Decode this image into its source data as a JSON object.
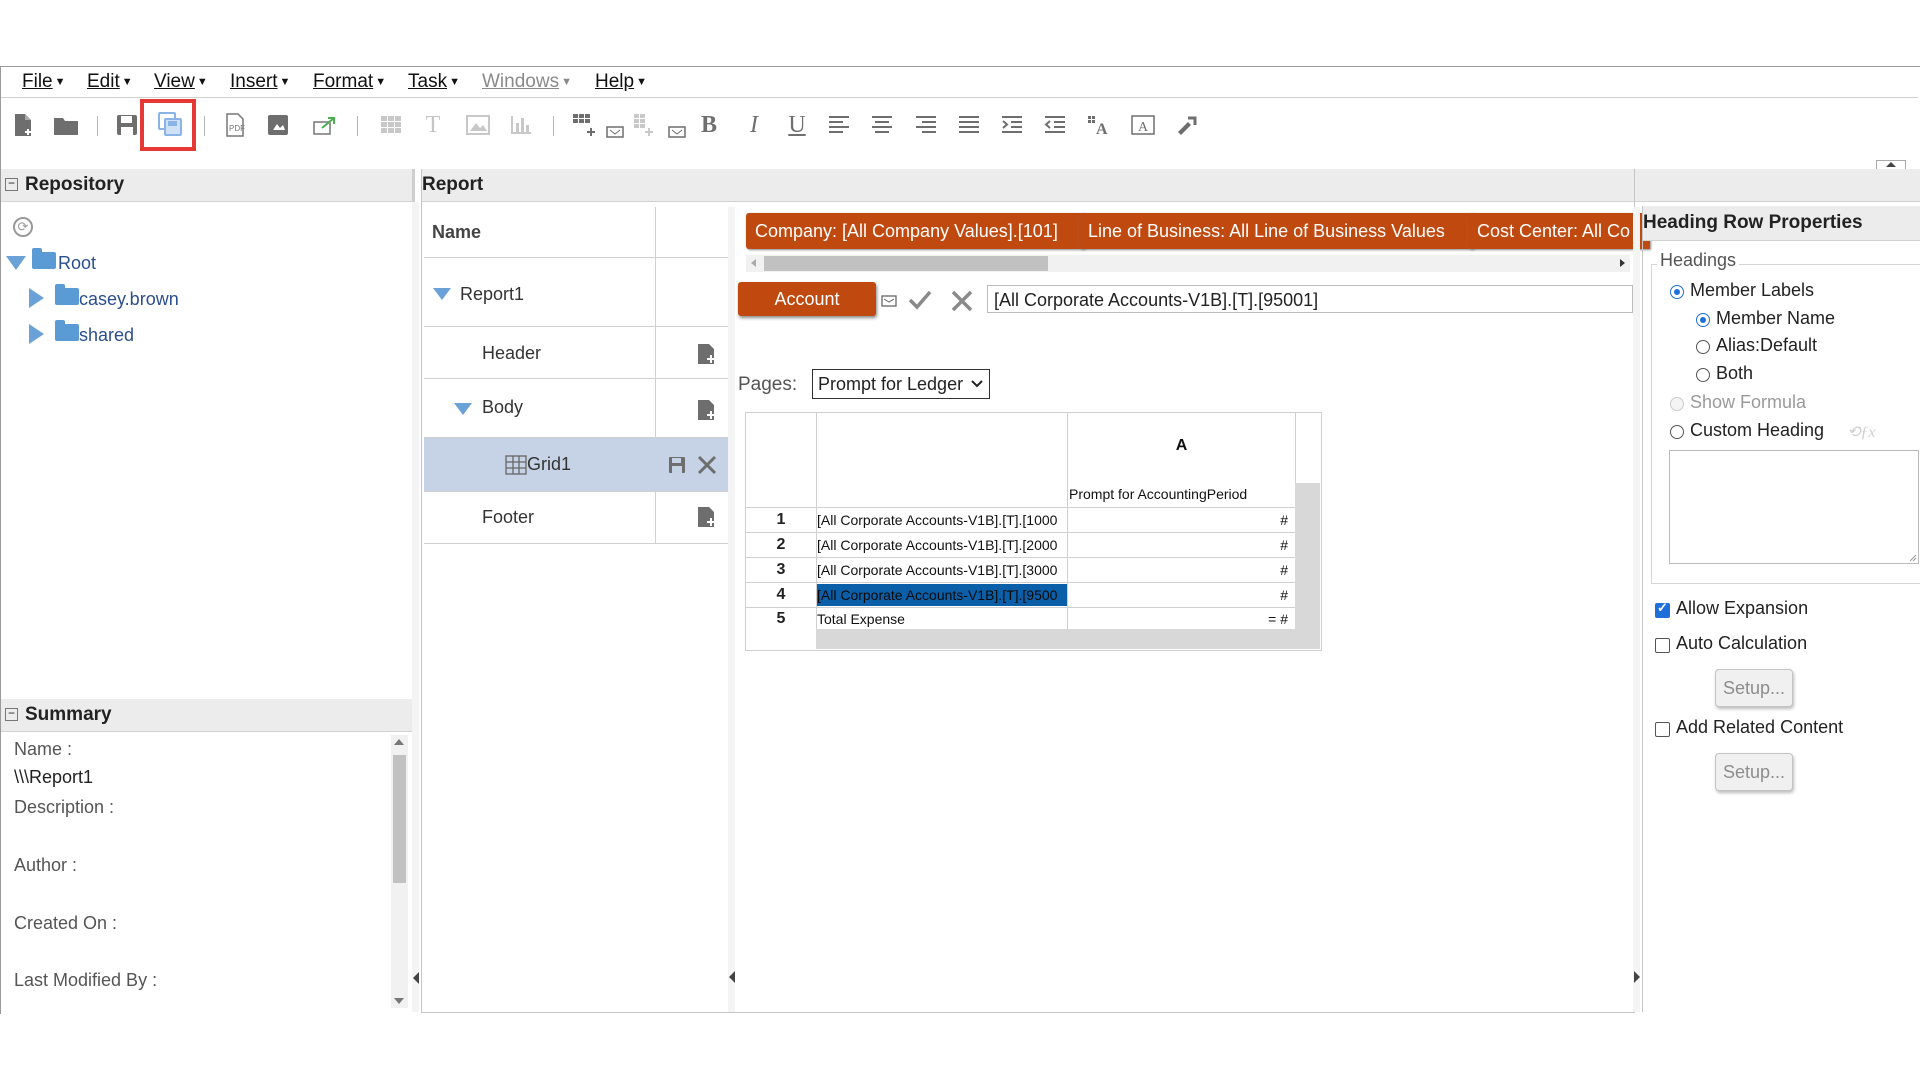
{
  "menu": [
    "File",
    "Edit",
    "View",
    "Insert",
    "Format",
    "Task",
    "Windows",
    "Help"
  ],
  "toolbar_icons": [
    "new-document-icon",
    "open-folder-icon",
    "save-icon",
    "save-as-icon",
    "export-pdf-icon",
    "preview-icon",
    "export-icon",
    "insert-grid-icon",
    "insert-text-icon",
    "insert-image-icon",
    "insert-chart-icon",
    "insert-row-icon",
    "insert-column-icon",
    "bold-icon",
    "italic-icon",
    "underline-icon",
    "align-left-icon",
    "align-center-icon",
    "align-right-icon",
    "justify-icon",
    "indent-icon",
    "outdent-icon",
    "font-icon",
    "text-box-icon",
    "format-painter-icon"
  ],
  "repository": {
    "title": "Repository",
    "items": [
      {
        "label": "Root"
      },
      {
        "label": "casey.brown"
      },
      {
        "label": "shared"
      }
    ]
  },
  "summary": {
    "title": "Summary",
    "name_label": "Name :",
    "name_value": "\\\\\\Report1",
    "description_label": "Description :",
    "author_label": "Author :",
    "created_label": "Created On :",
    "modified_label": "Last Modified By :"
  },
  "report": {
    "title": "Report",
    "nav_header": "Name",
    "nav": [
      "Report1",
      "Header",
      "Body",
      "Grid1",
      "Footer"
    ],
    "pov": [
      "Company: [All Company Values].[101]",
      "Line of Business: All Line of Business Values",
      "Cost Center: All Co"
    ],
    "account_button": "Account",
    "formula_value": "[All Corporate Accounts-V1B].[T].[95001]",
    "pages_label": "Pages:",
    "pages_select": "Prompt for Ledger",
    "grid": {
      "col_header": "A",
      "col_sub": "Prompt for AccountingPeriod",
      "rows": [
        {
          "num": "1",
          "label": "[All Corporate Accounts-V1B].[T].[1000",
          "value": "#"
        },
        {
          "num": "2",
          "label": "[All Corporate Accounts-V1B].[T].[2000",
          "value": "#"
        },
        {
          "num": "3",
          "label": "[All Corporate Accounts-V1B].[T].[3000",
          "value": "#"
        },
        {
          "num": "4",
          "label": "[All Corporate Accounts-V1B].[T].[9500",
          "value": "#"
        },
        {
          "num": "5",
          "label": "Total Expense",
          "value": "= #"
        }
      ]
    }
  },
  "properties": {
    "title": "Heading Row Properties",
    "headings_legend": "Headings",
    "member_labels": "Member Labels",
    "member_name": "Member Name",
    "alias_default": "Alias:Default",
    "both": "Both",
    "show_formula": "Show Formula",
    "custom_heading": "Custom Heading",
    "allow_expansion": "Allow Expansion",
    "auto_calculation": "Auto Calculation",
    "setup1": "Setup...",
    "add_related": "Add Related Content",
    "setup2": "Setup..."
  }
}
